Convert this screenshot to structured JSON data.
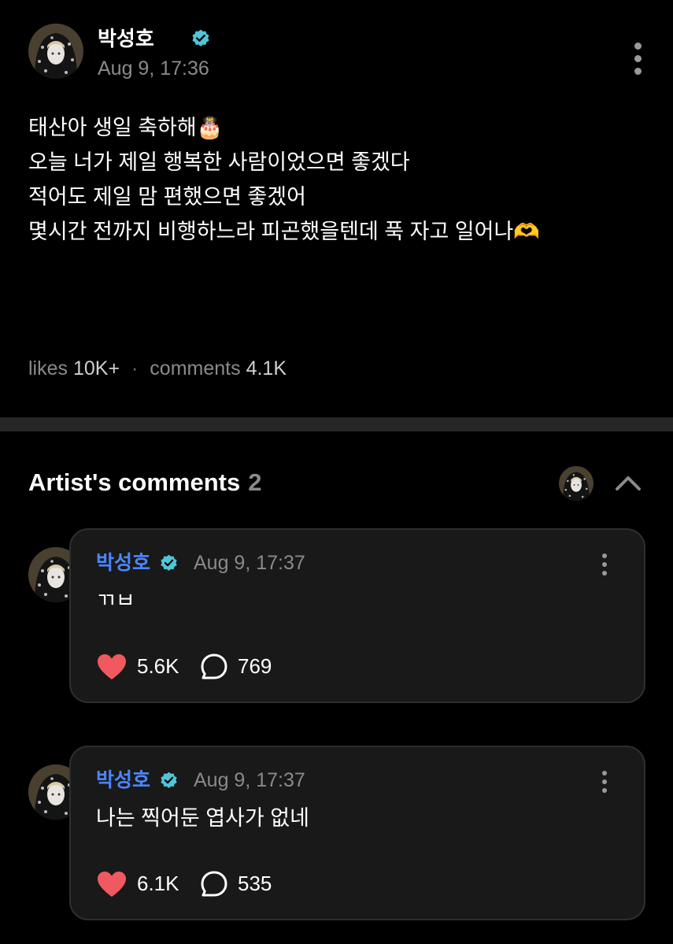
{
  "colors": {
    "background": "#000000",
    "accent_name": "#4b86ff",
    "verified": "#4fc6d8",
    "heart": "#f0595f",
    "muted_text": "#8a8a8a",
    "card_bg": "#191919"
  },
  "post": {
    "author": "박성호",
    "time": "Aug 9, 17:36",
    "lines": [
      "태산아 생일 축하해🎂",
      "오늘 너가 제일 행복한 사람이었으면 좋겠다",
      "적어도 제일 맘 편했으면 좋겠어",
      "몇시간 전까지 비행하느라 피곤했을텐데 푹 자고 일어나🫶"
    ],
    "stats": {
      "likes_label": "likes",
      "likes_value": "10K+",
      "separator": "·",
      "comments_label": "comments",
      "comments_value": "4.1K"
    }
  },
  "artist_comments": {
    "title": "Artist's comments",
    "count": "2",
    "collapse_icon": "chevron-up-icon",
    "items": [
      {
        "author": "박성호",
        "time": "Aug 9, 17:37",
        "text": "ㄲㅂ",
        "likes": "5.6K",
        "replies": "769"
      },
      {
        "author": "박성호",
        "time": "Aug 9, 17:37",
        "text": "나는 찍어둔 엽사가 없네",
        "likes": "6.1K",
        "replies": "535"
      }
    ]
  }
}
